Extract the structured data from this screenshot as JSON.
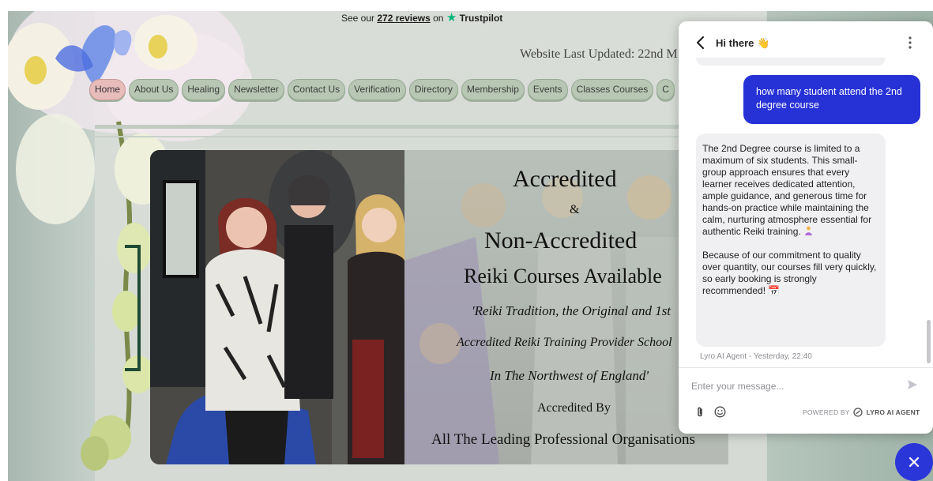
{
  "trustpilot": {
    "prefix": "See our",
    "count": "272 reviews",
    "on": "on",
    "brand": "Trustpilot"
  },
  "site": {
    "last_updated": "Website Last Updated: 22nd M"
  },
  "nav": {
    "items": [
      {
        "label": "Home",
        "active": true
      },
      {
        "label": "About Us"
      },
      {
        "label": "Healing"
      },
      {
        "label": "Newsletter"
      },
      {
        "label": "Contact Us"
      },
      {
        "label": "Verification"
      },
      {
        "label": "Directory"
      },
      {
        "label": "Membership"
      },
      {
        "label": "Events"
      },
      {
        "label": "Classes Courses"
      },
      {
        "label": "C"
      }
    ]
  },
  "banner": {
    "line1": "Accredited",
    "line2": "&",
    "line3": "Non-Accredited",
    "line4": "Reiki Courses Available",
    "line5": "'Reiki Tradition, the Original and 1st",
    "line6": "Accredited Reiki Training Provider School",
    "line7": "In The Northwest of England'",
    "line8": "Accredited By",
    "line9": "All The Leading Professional Organisations"
  },
  "chat": {
    "header_title": "Hi there 👋",
    "user_message": "how many student attend the 2nd degree course",
    "agent_message_p1": "The 2nd Degree course is limited to a maximum of six students. This small-group approach ensures that every learner receives dedicated attention, ample guidance, and generous time for hands-on practice while maintaining the calm, nurturing atmosphere essential for authentic Reiki training.",
    "agent_message_p2": "Because of our commitment to quality over quantity, our courses fill very quickly, so early booking is strongly recommended!",
    "calendar_emoji": "📅",
    "agent_meta": "Lyro AI Agent - Yesterday, 22:40",
    "input_placeholder": "Enter your message...",
    "powered_by": "POWERED BY",
    "powered_brand": "LYRO AI AGENT",
    "accent_color": "#2631d6"
  }
}
